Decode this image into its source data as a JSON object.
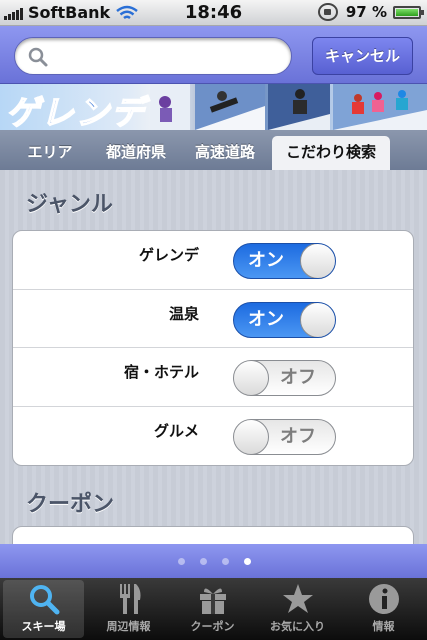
{
  "status_bar": {
    "carrier": "SoftBank",
    "time": "18:46",
    "battery": "97 %"
  },
  "search": {
    "placeholder": "",
    "cancel_label": "キャンセル"
  },
  "banner": {
    "title": "ゲレンデ"
  },
  "tabs": [
    {
      "label": "エリア",
      "active": false
    },
    {
      "label": "都道府県",
      "active": false
    },
    {
      "label": "高速道路",
      "active": false
    },
    {
      "label": "こだわり検索",
      "active": true
    }
  ],
  "genre": {
    "title": "ジャンル",
    "rows": [
      {
        "label": "ゲレンデ",
        "state": "オン",
        "on": true
      },
      {
        "label": "温泉",
        "state": "オン",
        "on": true
      },
      {
        "label": "宿・ホテル",
        "state": "オフ",
        "on": false
      },
      {
        "label": "グルメ",
        "state": "オフ",
        "on": false
      }
    ]
  },
  "coupon": {
    "title": "クーポン"
  },
  "page_indicator": {
    "total": 4,
    "current": 4
  },
  "bottom_tabs": [
    {
      "label": "スキー場",
      "icon": "search-icon",
      "active": true
    },
    {
      "label": "周辺情報",
      "icon": "fork-knife-icon",
      "active": false
    },
    {
      "label": "クーポン",
      "icon": "gift-icon",
      "active": false
    },
    {
      "label": "お気に入り",
      "icon": "star-icon",
      "active": false
    },
    {
      "label": "情報",
      "icon": "info-icon",
      "active": false
    }
  ],
  "colors": {
    "nav_blue": "#6a72d8",
    "switch_on": "#1d6be0",
    "section_title": "#4b5568"
  }
}
